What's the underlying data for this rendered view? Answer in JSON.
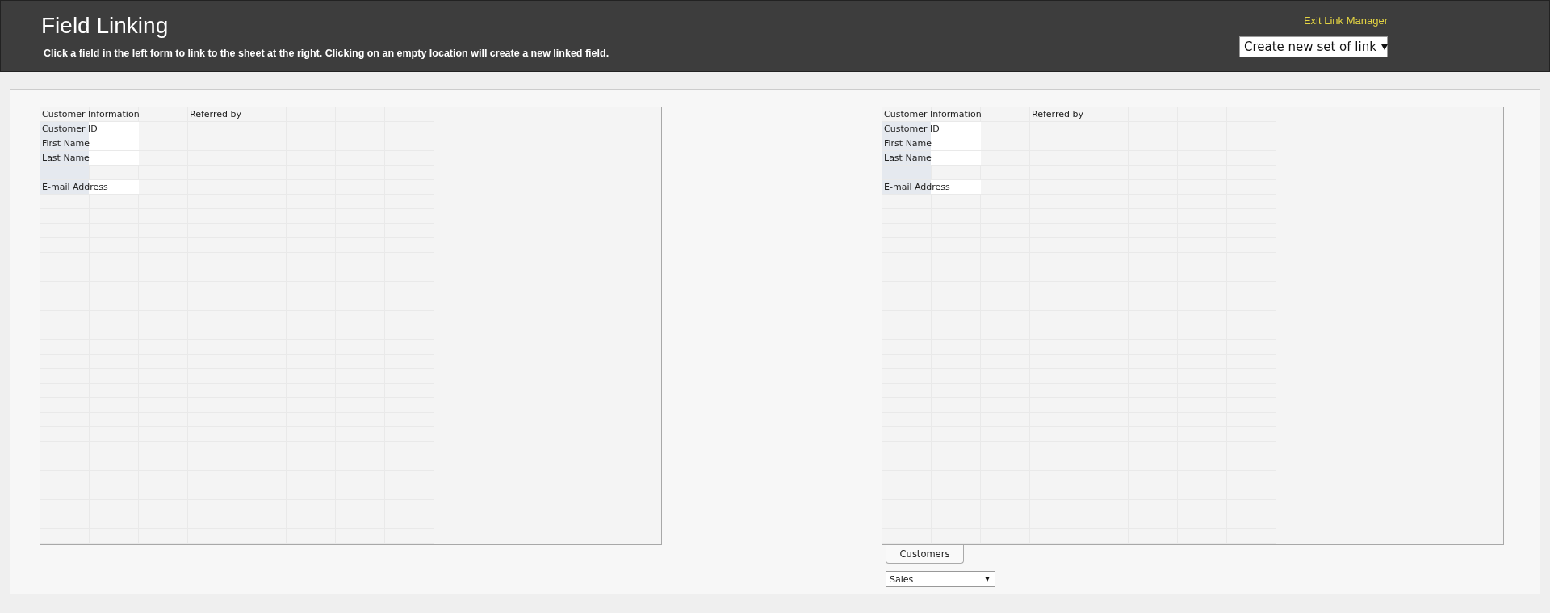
{
  "header": {
    "title": "Field Linking",
    "instructions": "Click a field in the left form to link to the sheet at the right. Clicking on an empty location will create a new linked field.",
    "exit_link": "Exit Link Manager",
    "link_set_select": "Create new set of link"
  },
  "sheets": [
    {
      "rows": [
        {
          "kind": "heading",
          "text": "Customer Information",
          "note": "Referred by"
        },
        {
          "kind": "field",
          "text": "Customer ID"
        },
        {
          "kind": "field",
          "text": "First Name"
        },
        {
          "kind": "field",
          "text": "Last Name"
        },
        {
          "kind": "blank"
        },
        {
          "kind": "field",
          "text": "E-mail Address"
        }
      ]
    },
    {
      "rows": [
        {
          "kind": "heading",
          "text": "Customer Information",
          "note": "Referred by"
        },
        {
          "kind": "field",
          "text": "Customer ID"
        },
        {
          "kind": "field",
          "text": "First Name"
        },
        {
          "kind": "field",
          "text": "Last Name"
        },
        {
          "kind": "blank"
        },
        {
          "kind": "field",
          "text": "E-mail Address"
        }
      ],
      "tabs": [
        "Customers"
      ],
      "form_select": "Sales"
    }
  ]
}
